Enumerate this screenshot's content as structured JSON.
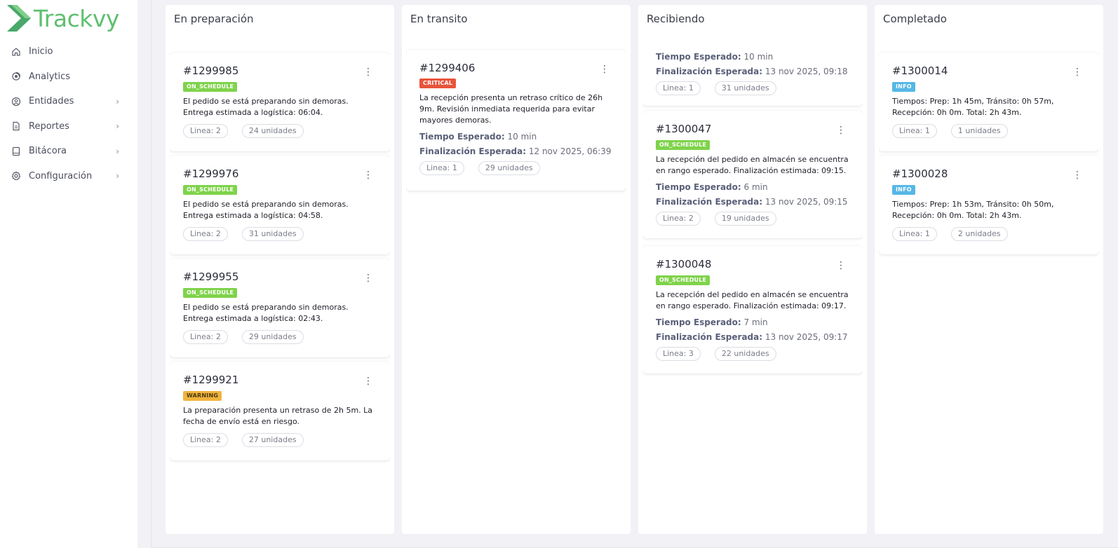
{
  "app": {
    "name": "Trackvy",
    "brand_color": "#5fbf6f"
  },
  "sidebar": {
    "items": [
      {
        "label": "Inicio",
        "icon": "home-icon",
        "has_submenu": false
      },
      {
        "label": "Analytics",
        "icon": "analytics-icon",
        "has_submenu": false
      },
      {
        "label": "Entidades",
        "icon": "user-circle-icon",
        "has_submenu": true
      },
      {
        "label": "Reportes",
        "icon": "report-icon",
        "has_submenu": true
      },
      {
        "label": "Bitácora",
        "icon": "book-icon",
        "has_submenu": true
      },
      {
        "label": "Configuración",
        "icon": "gear-icon",
        "has_submenu": true
      }
    ]
  },
  "columns": [
    {
      "title": "En preparación",
      "cards": [
        {
          "id": "#1299985",
          "status": "ON_SCHEDULE",
          "description": "El pedido se está preparando sin demoras. Entrega estimada a logística: 06:04.",
          "line": "Linea: 2",
          "units": "24 unidades"
        },
        {
          "id": "#1299976",
          "status": "ON_SCHEDULE",
          "description": "El pedido se está preparando sin demoras. Entrega estimada a logística: 04:58.",
          "line": "Linea: 2",
          "units": "31 unidades"
        },
        {
          "id": "#1299955",
          "status": "ON_SCHEDULE",
          "description": "El pedido se está preparando sin demoras. Entrega estimada a logística: 02:43.",
          "line": "Linea: 2",
          "units": "29 unidades"
        },
        {
          "id": "#1299921",
          "status": "WARNING",
          "description": "La preparación presenta un retraso de 2h 5m. La fecha de envío está en riesgo.",
          "line": "Linea: 2",
          "units": "27 unidades"
        }
      ]
    },
    {
      "title": "En transito",
      "cards": [
        {
          "id": "#1299406",
          "status": "CRITICAL",
          "description": "La recepción presenta un retraso crítico de 26h 9m. Revisión inmediata requerida para evitar mayores demoras.",
          "expected_time_label": "Tiempo Esperado:",
          "expected_time": "10 min",
          "expected_end_label": "Finalización Esperada:",
          "expected_end": "12 nov 2025, 06:39",
          "line": "Linea: 1",
          "units": "29 unidades"
        }
      ]
    },
    {
      "title": "Recibiendo",
      "cards": [
        {
          "id": "",
          "status": "",
          "description": "",
          "expected_time_label": "Tiempo Esperado:",
          "expected_time": "10 min",
          "expected_end_label": "Finalización Esperada:",
          "expected_end": "13 nov 2025, 09:18",
          "line": "Linea: 1",
          "units": "31 unidades"
        },
        {
          "id": "#1300047",
          "status": "ON_SCHEDULE",
          "description": "La recepción del pedido en almacén se encuentra en rango esperado. Finalización estimada: 09:15.",
          "expected_time_label": "Tiempo Esperado:",
          "expected_time": "6 min",
          "expected_end_label": "Finalización Esperada:",
          "expected_end": "13 nov 2025, 09:15",
          "line": "Linea: 2",
          "units": "19 unidades"
        },
        {
          "id": "#1300048",
          "status": "ON_SCHEDULE",
          "description": "La recepción del pedido en almacén se encuentra en rango esperado. Finalización estimada: 09:17.",
          "expected_time_label": "Tiempo Esperado:",
          "expected_time": "7 min",
          "expected_end_label": "Finalización Esperada:",
          "expected_end": "13 nov 2025, 09:17",
          "line": "Linea: 3",
          "units": "22 unidades"
        }
      ]
    },
    {
      "title": "Completado",
      "cards": [
        {
          "id": "#1300014",
          "status": "INFO",
          "description": "Tiempos: Prep: 1h 45m, Tránsito: 0h 57m, Recepción: 0h 0m. Total: 2h 43m.",
          "line": "Linea: 1",
          "units": "1 unidades"
        },
        {
          "id": "#1300028",
          "status": "INFO",
          "description": "Tiempos: Prep: 1h 53m, Tránsito: 0h 50m, Recepción: 0h 0m. Total: 2h 43m.",
          "line": "Linea: 1",
          "units": "2 unidades"
        }
      ]
    }
  ],
  "status_colors": {
    "ON_SCHEDULE": "#7fd34b",
    "CRITICAL": "#e8543b",
    "WARNING": "#f0b43e",
    "INFO": "#56b7e6"
  }
}
